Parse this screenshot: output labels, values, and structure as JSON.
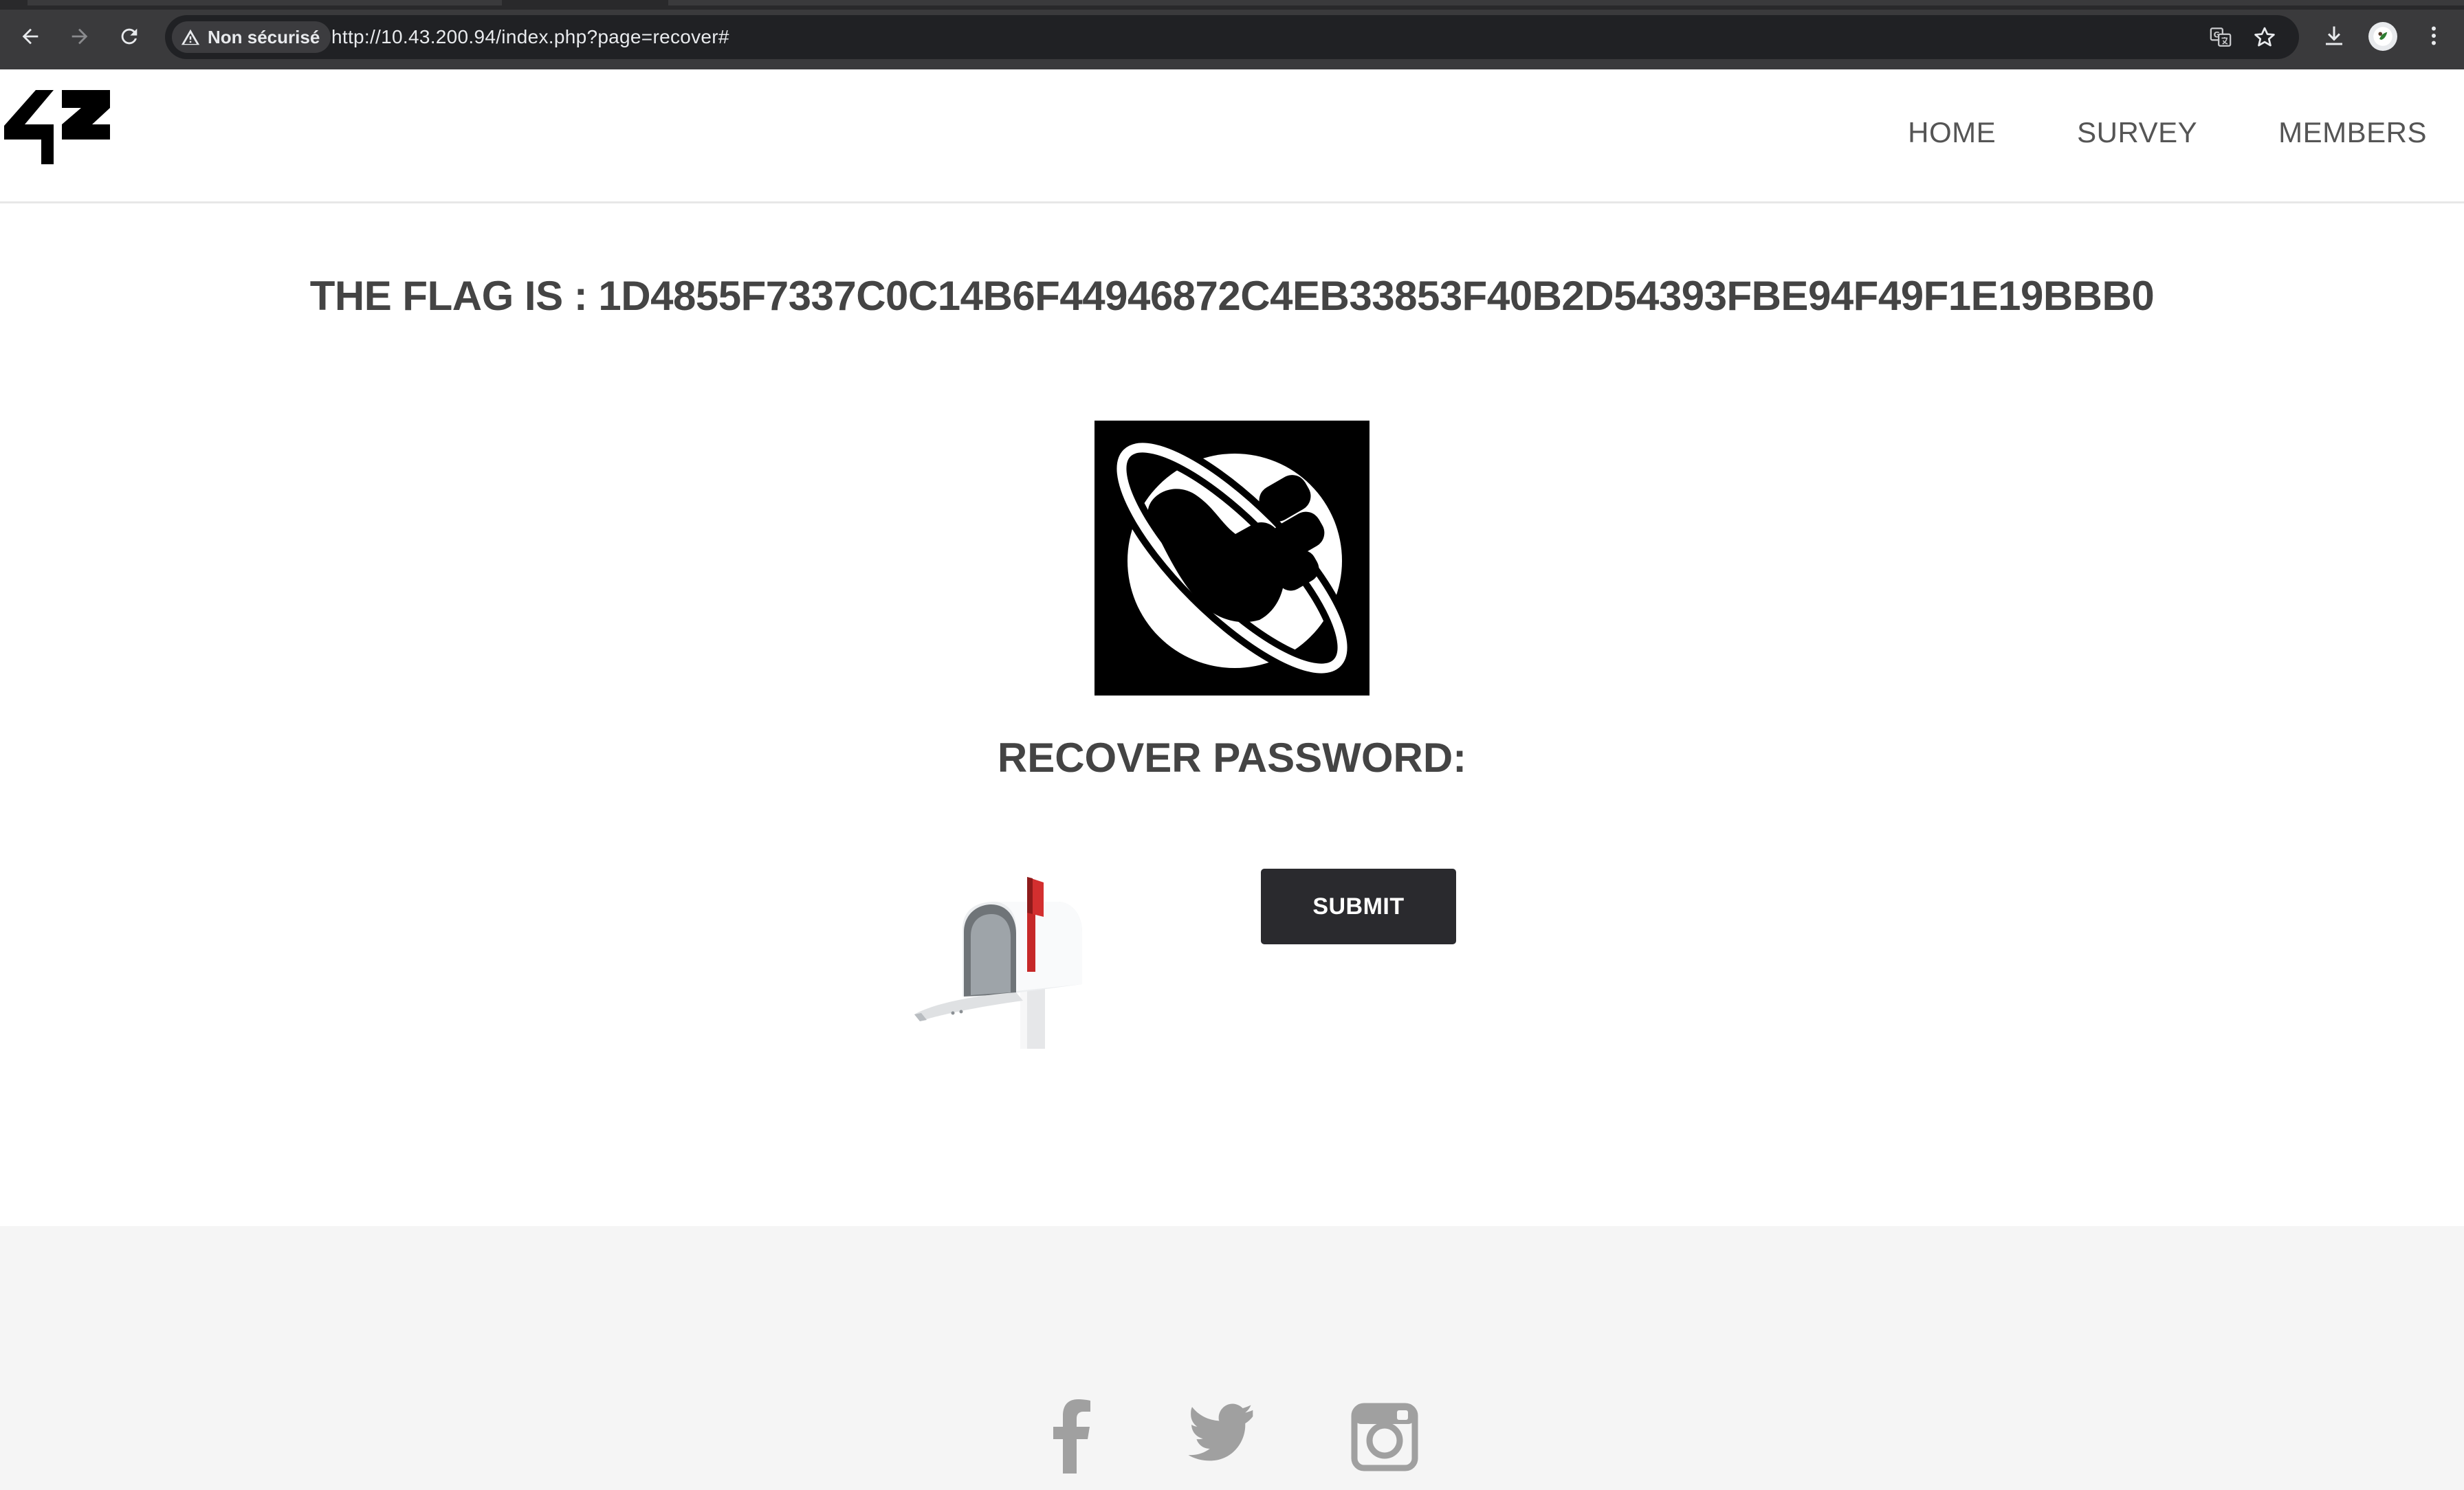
{
  "browser": {
    "security_label": "Non sécurisé",
    "url": "http://10.43.200.94/index.php?page=recover#"
  },
  "header": {
    "logo_text": "42",
    "nav": {
      "home": "HOME",
      "survey": "SURVEY",
      "members": "MEMBERS"
    }
  },
  "main": {
    "flag": "THE FLAG IS : 1D4855F7337C0C14B6F44946872C4EB33853F40B2D54393FBE94F49F1E19BBB0",
    "logo_icon": "thumbs-up-planet-icon",
    "recover_title": "RECOVER PASSWORD:",
    "mailbox_icon": "mailbox-icon",
    "submit_label": "SUBMIT"
  },
  "footer": {
    "social_icons": [
      "facebook-icon",
      "twitter-icon",
      "instagram-icon"
    ]
  },
  "colors": {
    "chrome_bg": "#3a3a3c",
    "omnibox_bg": "#202124",
    "heading_text": "#444444",
    "nav_text": "#555555",
    "button_bg": "#2a2a2e",
    "footer_bg": "#f5f5f5",
    "social_icon": "#a0a0a0",
    "mailbox_flag": "#c62828"
  }
}
